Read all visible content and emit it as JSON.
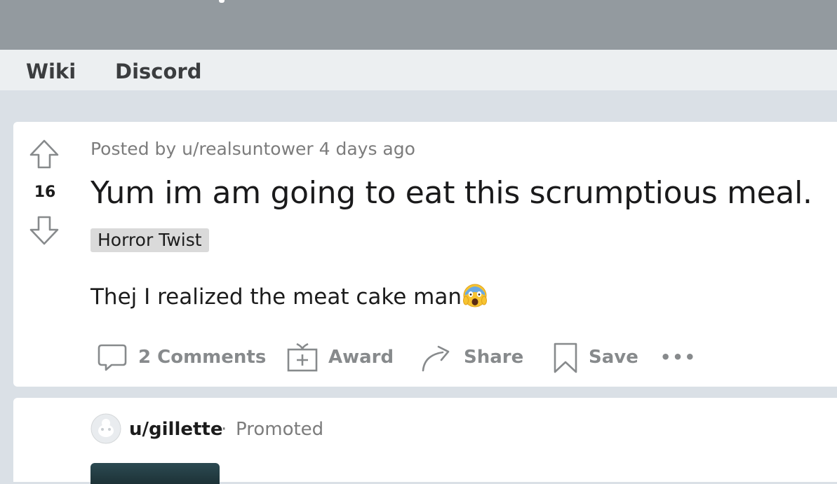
{
  "subnav": {
    "items": [
      {
        "label": "Wiki"
      },
      {
        "label": "Discord"
      }
    ]
  },
  "post": {
    "meta": "Posted by u/realsuntower 4 days ago",
    "score": "16",
    "title": "Yum im am going to eat this scrumptious meal.",
    "flair": "Horror Twist",
    "body": "Thej I realized the meat cake man",
    "body_emoji": "screaming-face-emoji",
    "actions": {
      "comments": "2 Comments",
      "award": "Award",
      "share": "Share",
      "save": "Save",
      "more": "•••"
    }
  },
  "promo": {
    "user": "u/gillette",
    "separator": "·",
    "label": "Promoted"
  },
  "colors": {
    "banner": "#939a9f",
    "page_background": "#dae0e6",
    "subnav_background": "#eceff1",
    "action_text": "#878a8c",
    "flair_background": "#dadada"
  }
}
